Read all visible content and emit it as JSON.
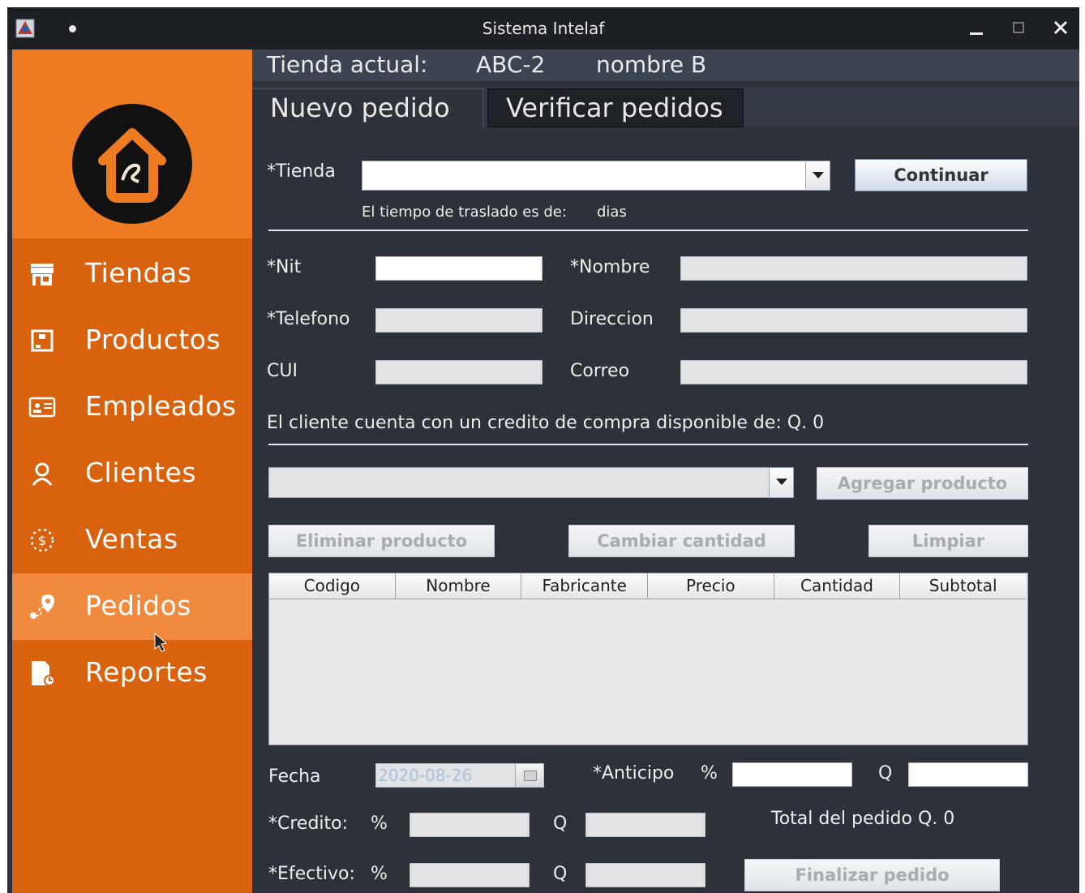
{
  "window": {
    "title": "Sistema Intelaf"
  },
  "sidebar": {
    "items": [
      {
        "label": "Tiendas",
        "icon": "store-icon",
        "active": false
      },
      {
        "label": "Productos",
        "icon": "product-box-icon",
        "active": false
      },
      {
        "label": "Empleados",
        "icon": "id-card-icon",
        "active": false
      },
      {
        "label": "Clientes",
        "icon": "user-icon",
        "active": false
      },
      {
        "label": "Ventas",
        "icon": "sales-money-icon",
        "active": false
      },
      {
        "label": "Pedidos",
        "icon": "location-route-icon",
        "active": true
      },
      {
        "label": "Reportes",
        "icon": "report-document-icon",
        "active": false
      }
    ]
  },
  "store_bar": {
    "label": "Tienda actual:",
    "code": "ABC-2",
    "name": "nombre B"
  },
  "tabs": [
    {
      "label": "Nuevo pedido",
      "active": false
    },
    {
      "label": "Verificar pedidos",
      "active": true
    }
  ],
  "form": {
    "tienda_label": "*Tienda",
    "tienda_value": "",
    "continuar_label": "Continuar",
    "traslado_text": "El tiempo de traslado es de:",
    "traslado_unit": "dias",
    "nit_label": "*Nit",
    "nombre_label": "*Nombre",
    "telefono_label": "*Telefono",
    "direccion_label": "Direccion",
    "cui_label": "CUI",
    "correo_label": "Correo",
    "credit_text": "El cliente cuenta con un credito de compra disponible de: Q. 0",
    "agregar_label": "Agregar producto",
    "eliminar_label": "Eliminar producto",
    "cambiar_label": "Cambiar cantidad",
    "limpiar_label": "Limpiar",
    "table_columns": [
      "Codigo",
      "Nombre",
      "Fabricante",
      "Precio",
      "Cantidad",
      "Subtotal"
    ],
    "fecha_label": "Fecha",
    "fecha_value": "2020-08-26",
    "anticipo_label": "*Anticipo",
    "percent_symbol": "%",
    "q_symbol": "Q",
    "credito_label": "*Credito:",
    "efectivo_label": "*Efectivo:",
    "total_text": "Total del pedido Q. 0",
    "finalizar_label": "Finalizar pedido"
  },
  "colors": {
    "sidebar": "#d9620e",
    "sidebar_logo_bg": "#ee7a22",
    "sidebar_active": "#ef8a3f",
    "main_bg": "#2c313a",
    "titlebar": "#1c1f24"
  }
}
